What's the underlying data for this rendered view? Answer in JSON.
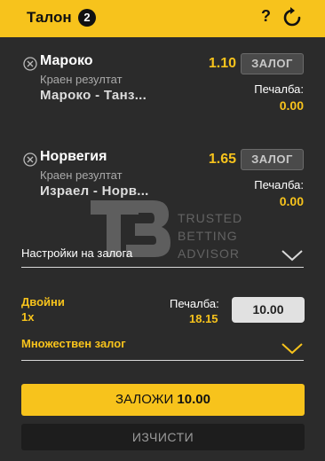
{
  "header": {
    "title": "Талон",
    "count": "2",
    "help": "?",
    "refresh_icon": "refresh-icon"
  },
  "bets": [
    {
      "selection": "Мароко",
      "market": "Краен резултат",
      "event": "Мароко - Танз...",
      "odds": "1.10",
      "stake_placeholder": "ЗАЛОГ",
      "win_label": "Печалба:",
      "win_value": "0.00"
    },
    {
      "selection": "Норвегия",
      "market": "Краен резултат",
      "event": "Израел - Норв...",
      "odds": "1.65",
      "stake_placeholder": "ЗАЛОГ",
      "win_label": "Печалба:",
      "win_value": "0.00"
    }
  ],
  "watermark": {
    "line1": "TRUSTED",
    "line2": "BETTING",
    "line3": "ADVISOR"
  },
  "settings": {
    "label": "Настройки на залога"
  },
  "double": {
    "name": "Двойни",
    "multiplier": "1x",
    "win_label": "Печалба:",
    "win_value": "18.15",
    "stake": "10.00"
  },
  "multiple": {
    "label": "Множествен залог"
  },
  "actions": {
    "place_label": "ЗАЛОЖИ",
    "place_amount": "10.00",
    "clear_label": "ИЗЧИСТИ"
  },
  "colors": {
    "accent": "#f7c31c",
    "background": "#2b2b2b",
    "clear_button": "#1d1d1d"
  }
}
